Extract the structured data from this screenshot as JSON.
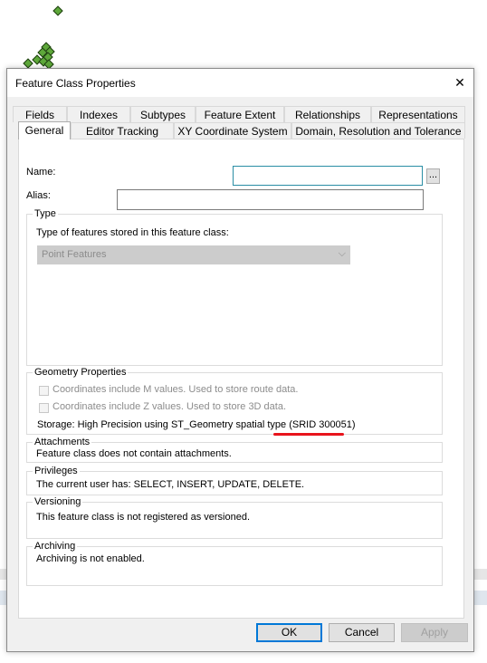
{
  "window": {
    "title": "Feature Class Properties",
    "close_glyph": "✕"
  },
  "tabs_row1": [
    "Fields",
    "Indexes",
    "Subtypes",
    "Feature Extent",
    "Relationships",
    "Representations"
  ],
  "tabs_row2": [
    "General",
    "Editor Tracking",
    "XY Coordinate System",
    "Domain, Resolution and Tolerance"
  ],
  "active_tab": "General",
  "general": {
    "name_label": "Name:",
    "name_value": "",
    "browse_label": "...",
    "alias_label": "Alias:",
    "alias_value": ""
  },
  "type_group": {
    "title": "Type",
    "prompt": "Type of features stored in this feature class:",
    "selected": "Point Features"
  },
  "geometry_group": {
    "title": "Geometry Properties",
    "m_values_label": "Coordinates include M values. Used to store route data.",
    "z_values_label": "Coordinates include Z values. Used to store 3D data.",
    "storage_text": "Storage: High Precision using ST_Geometry spatial type ",
    "srid_text": "(SRID 300051)",
    "highlight_color": "#e8141c"
  },
  "attachments": {
    "title": "Attachments",
    "text": "Feature class does not contain attachments."
  },
  "privileges": {
    "title": "Privileges",
    "text": "The current user has: SELECT, INSERT, UPDATE, DELETE."
  },
  "versioning": {
    "title": "Versioning",
    "text": "This feature class is not registered as versioned."
  },
  "archiving": {
    "title": "Archiving",
    "text": "Archiving is not enabled."
  },
  "buttons": {
    "ok": "OK",
    "cancel": "Cancel",
    "apply": "Apply"
  },
  "colors": {
    "accent": "#0078d7",
    "point_fill": "#5ea83a"
  }
}
